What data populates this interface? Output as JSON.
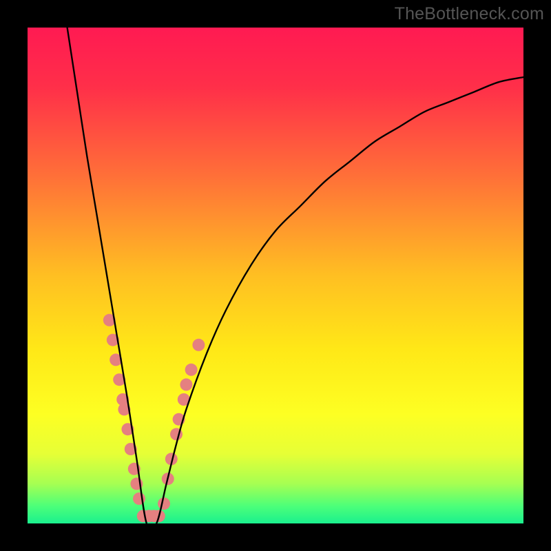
{
  "watermark": "TheBottleneck.com",
  "gradient": {
    "stops": [
      {
        "offset": 0.0,
        "color": "#ff1a52"
      },
      {
        "offset": 0.12,
        "color": "#ff2f49"
      },
      {
        "offset": 0.3,
        "color": "#ff7038"
      },
      {
        "offset": 0.5,
        "color": "#ffbf22"
      },
      {
        "offset": 0.65,
        "color": "#ffe817"
      },
      {
        "offset": 0.78,
        "color": "#fdff23"
      },
      {
        "offset": 0.86,
        "color": "#e6ff36"
      },
      {
        "offset": 0.92,
        "color": "#a6ff52"
      },
      {
        "offset": 0.965,
        "color": "#4cff79"
      },
      {
        "offset": 1.0,
        "color": "#1af08e"
      }
    ]
  },
  "chart_data": {
    "type": "line",
    "title": "",
    "xlabel": "",
    "ylabel": "",
    "xlim": [
      0,
      100
    ],
    "ylim": [
      0,
      100
    ],
    "grid": false,
    "curve_note": "Single V-shaped curve: y is bottleneck magnitude (%), 0 at the balanced point near x≈24. Values estimated from pixel positions; no axis ticks or labels shown in source.",
    "series": [
      {
        "name": "bottleneck-curve",
        "color": "#000000",
        "x": [
          8,
          10,
          12,
          14,
          16,
          18,
          20,
          22,
          24,
          26,
          28,
          30,
          32,
          36,
          40,
          45,
          50,
          55,
          60,
          65,
          70,
          75,
          80,
          85,
          90,
          95,
          100
        ],
        "y": [
          100,
          87,
          74,
          62,
          50,
          38,
          26,
          13,
          0,
          0,
          8,
          16,
          23,
          34,
          43,
          52,
          59,
          64,
          69,
          73,
          77,
          80,
          83,
          85,
          87,
          89,
          90
        ]
      }
    ],
    "markers": {
      "name": "highlight-dots",
      "color": "#e58080",
      "radius_px": 9,
      "points": [
        {
          "x": 16.5,
          "y": 41
        },
        {
          "x": 17.2,
          "y": 37
        },
        {
          "x": 17.8,
          "y": 33
        },
        {
          "x": 18.5,
          "y": 29
        },
        {
          "x": 19.2,
          "y": 25
        },
        {
          "x": 19.5,
          "y": 23
        },
        {
          "x": 20.2,
          "y": 19
        },
        {
          "x": 20.8,
          "y": 15
        },
        {
          "x": 21.5,
          "y": 11
        },
        {
          "x": 22.0,
          "y": 8
        },
        {
          "x": 22.5,
          "y": 5
        },
        {
          "x": 23.3,
          "y": 1.5
        },
        {
          "x": 24.5,
          "y": 1.5
        },
        {
          "x": 25.5,
          "y": 1.5
        },
        {
          "x": 26.5,
          "y": 1.5
        },
        {
          "x": 27.5,
          "y": 4
        },
        {
          "x": 28.3,
          "y": 9
        },
        {
          "x": 29.0,
          "y": 13
        },
        {
          "x": 30.0,
          "y": 18
        },
        {
          "x": 30.5,
          "y": 21
        },
        {
          "x": 31.5,
          "y": 25
        },
        {
          "x": 32.0,
          "y": 28
        },
        {
          "x": 33.0,
          "y": 31
        },
        {
          "x": 34.5,
          "y": 36
        }
      ]
    }
  }
}
